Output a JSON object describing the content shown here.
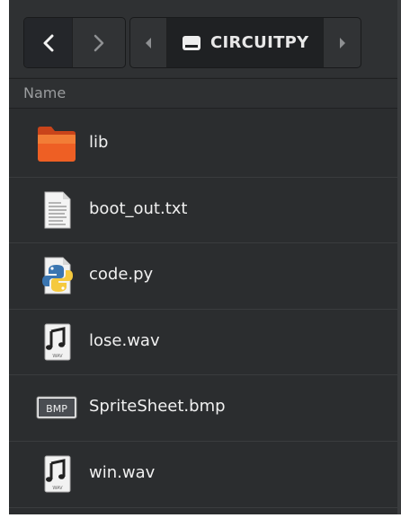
{
  "toolbar": {
    "back_icon": "chevron-left-icon",
    "forward_icon": "chevron-right-icon",
    "path_prev_icon": "triangle-left-icon",
    "path_next_icon": "triangle-right-icon",
    "drive_icon": "drive-icon",
    "current_location": "CIRCUITPY"
  },
  "list_header": {
    "name_column": "Name"
  },
  "files": [
    {
      "name": "lib",
      "icon": "folder-icon"
    },
    {
      "name": "boot_out.txt",
      "icon": "text-file-icon"
    },
    {
      "name": "code.py",
      "icon": "python-file-icon"
    },
    {
      "name": "lose.wav",
      "icon": "audio-file-icon"
    },
    {
      "name": "SpriteSheet.bmp",
      "icon": "bmp-file-icon"
    },
    {
      "name": "win.wav",
      "icon": "audio-file-icon"
    }
  ],
  "colors": {
    "background": "#2b2d2f",
    "folder_orange": "#e8561e",
    "text": "#f0f0f0"
  }
}
